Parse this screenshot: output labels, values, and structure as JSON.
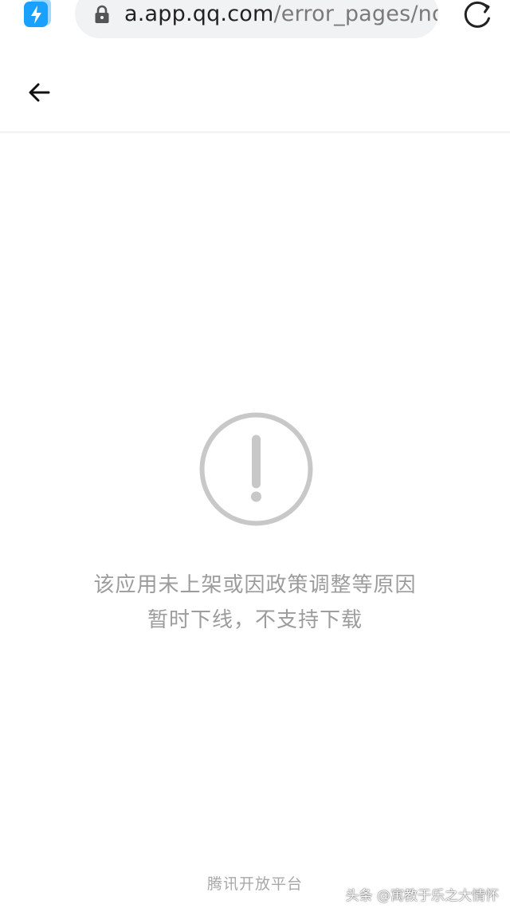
{
  "browser": {
    "url_host": "a.app.qq.com",
    "url_path": "/error_pages/no",
    "app_icon": "lightning-bolt-icon",
    "lock_icon": "lock-icon",
    "reload_icon": "reload-icon",
    "accent_color": "#1aa0ff"
  },
  "header": {
    "back_icon": "arrow-left-icon"
  },
  "error": {
    "icon": "exclamation-circle-icon",
    "line1": "该应用未上架或因政策调整等原因",
    "line2": "暂时下线，不支持下载"
  },
  "footer": {
    "brand": "腾讯开放平台"
  },
  "watermark": {
    "text": "头条 @寓教于乐之大情怀"
  }
}
